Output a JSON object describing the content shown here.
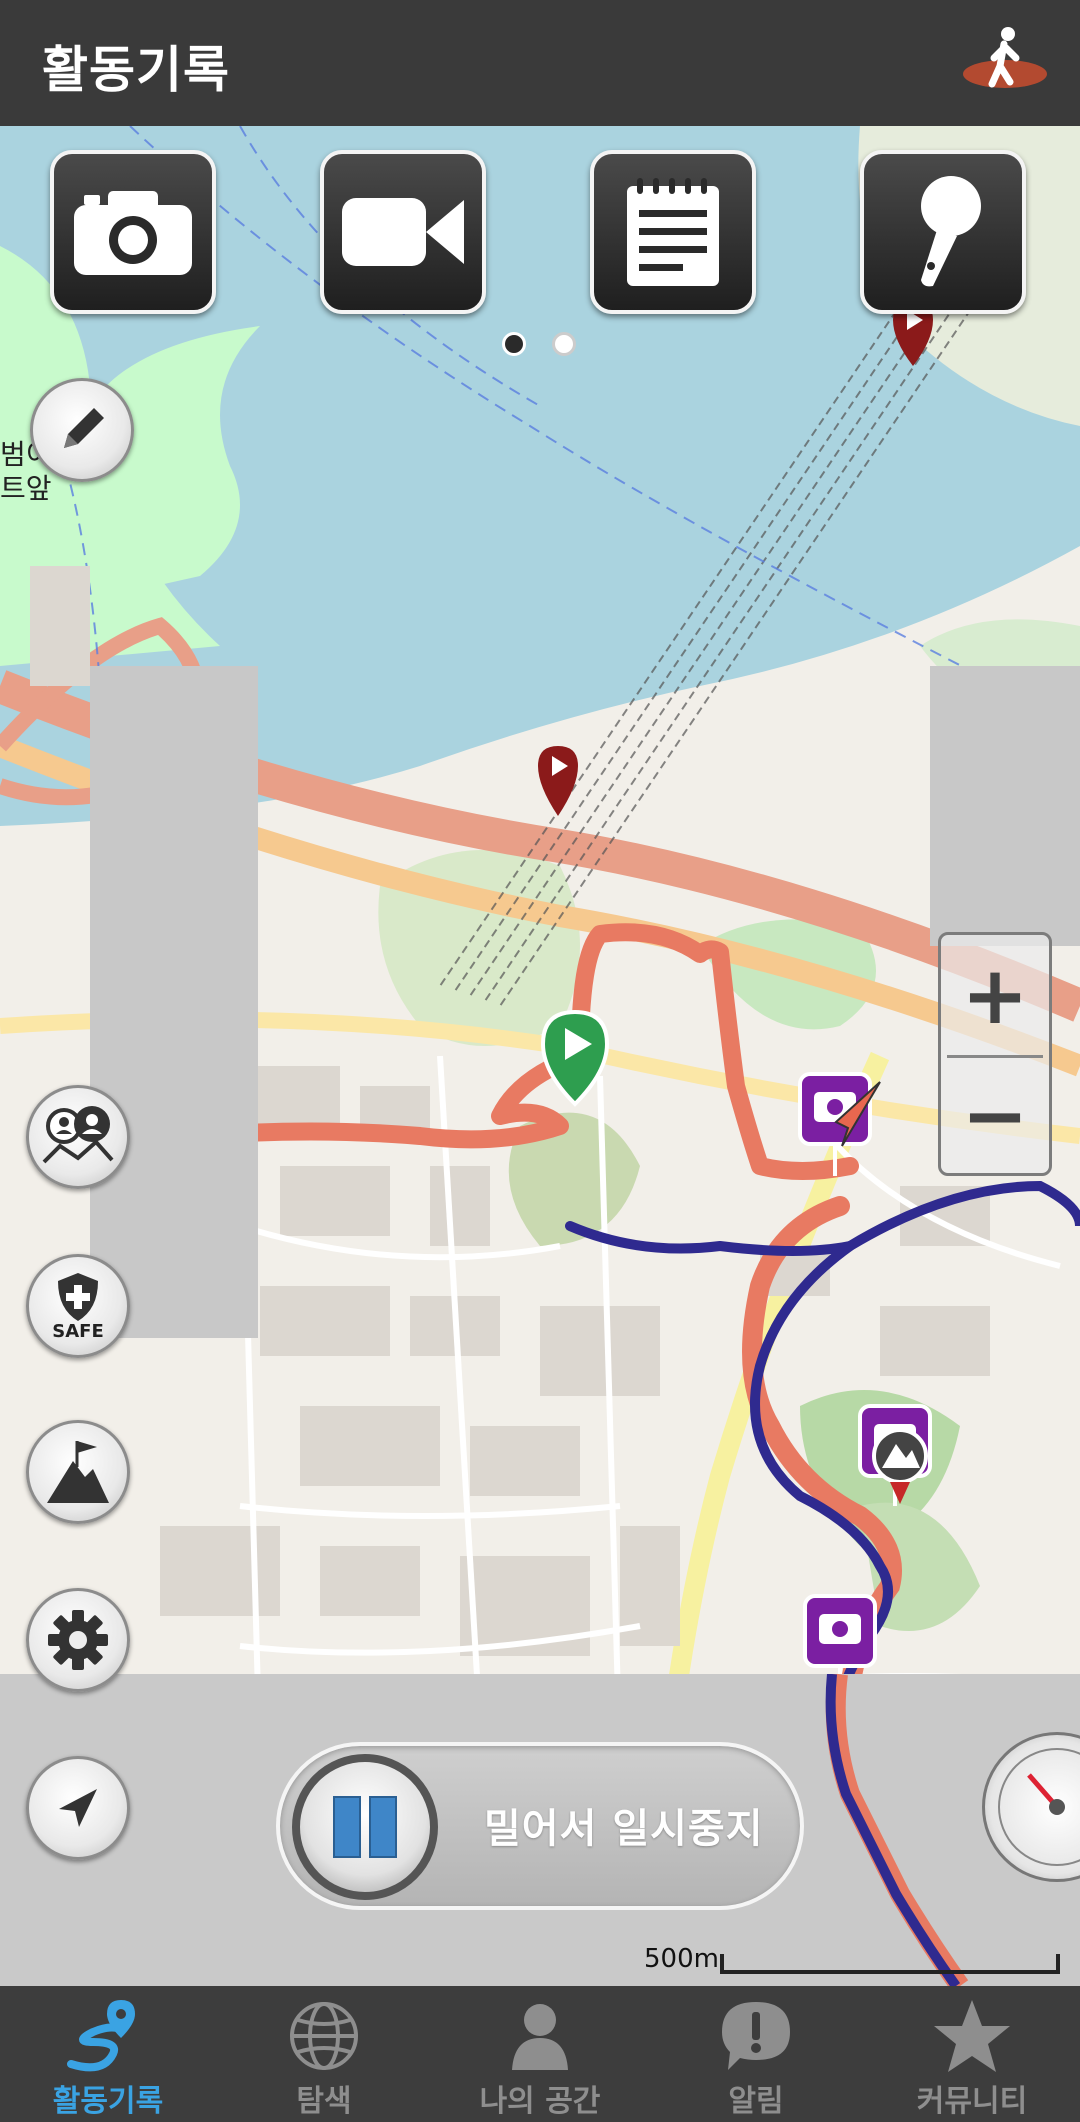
{
  "header": {
    "title": "활동기록",
    "mode_icon": "walking-person-icon"
  },
  "media_buttons": [
    {
      "name": "camera-button",
      "icon": "camera-icon"
    },
    {
      "name": "video-button",
      "icon": "video-camera-icon"
    },
    {
      "name": "memo-button",
      "icon": "notepad-icon"
    },
    {
      "name": "voice-button",
      "icon": "microphone-icon"
    }
  ],
  "pager": {
    "pages": 2,
    "current": 1
  },
  "side_buttons": [
    {
      "name": "edit-button",
      "icon": "pencil-icon"
    },
    {
      "name": "companions-button",
      "icon": "people-map-icon"
    },
    {
      "name": "safe-button",
      "icon": "shield-icon",
      "label": "SAFE"
    },
    {
      "name": "summit-button",
      "icon": "mountain-flag-icon"
    },
    {
      "name": "settings-button",
      "icon": "gear-icon"
    },
    {
      "name": "locate-button",
      "icon": "navigation-arrow-icon"
    }
  ],
  "map": {
    "labels": {
      "left_edge_1": "범이",
      "left_edge_2": "트앞"
    },
    "colors": {
      "track": "#e87a62",
      "route": "#2f2a8f",
      "water": "#aad3df",
      "park": "#c8facc"
    }
  },
  "zoom": {
    "in_label": "+",
    "out_label": "−"
  },
  "pause_slider": {
    "label": "밀어서 일시중지"
  },
  "scale": {
    "label": "500m"
  },
  "tabs": [
    {
      "label": "활동기록",
      "icon": "route-pin-icon",
      "active": true
    },
    {
      "label": "탐색",
      "icon": "globe-icon",
      "active": false
    },
    {
      "label": "나의 공간",
      "icon": "person-icon",
      "active": false
    },
    {
      "label": "알림",
      "icon": "alert-bubble-icon",
      "active": false
    },
    {
      "label": "커뮤니티",
      "icon": "star-icon",
      "active": false
    }
  ],
  "colors": {
    "accent": "#3aa3e3",
    "header_bg": "#3a3a3a",
    "tab_bg": "#3d3d3d",
    "photo_marker": "#7b1fa2"
  }
}
